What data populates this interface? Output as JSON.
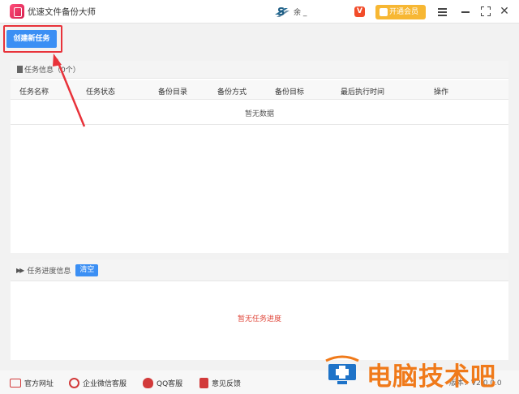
{
  "titlebar": {
    "app_title": "优速文件备份大师",
    "user_name": "余 _",
    "vip_label": "开通会员"
  },
  "toolbar": {
    "create_label": "创建新任务"
  },
  "task_panel": {
    "title": "任务信息（0个）",
    "columns": [
      "任务名称",
      "任务状态",
      "备份目录",
      "备份方式",
      "备份目标",
      "最后执行时间",
      "操作"
    ],
    "empty_text": "暂无数据"
  },
  "progress_panel": {
    "title": "任务进度信息",
    "clear_label": "清空",
    "empty_text": "暂无任务进度"
  },
  "footer": {
    "links": [
      "官方网址",
      "企业微信客服",
      "QQ客服",
      "意见反馈"
    ],
    "version": "版本：V2.0.0.0"
  },
  "watermark": {
    "text": "电脑技术吧"
  },
  "colors": {
    "accent": "#3b8ff4",
    "annotation": "#e8323a",
    "empty_progress": "#e0473b",
    "vip": "#f7b733"
  },
  "icons": [
    "app-logo-icon",
    "menu-icon",
    "minimize-icon",
    "maximize-icon",
    "close-icon",
    "document-icon",
    "fast-forward-icon",
    "website-icon",
    "wechat-icon",
    "qq-icon",
    "feedback-icon"
  ]
}
